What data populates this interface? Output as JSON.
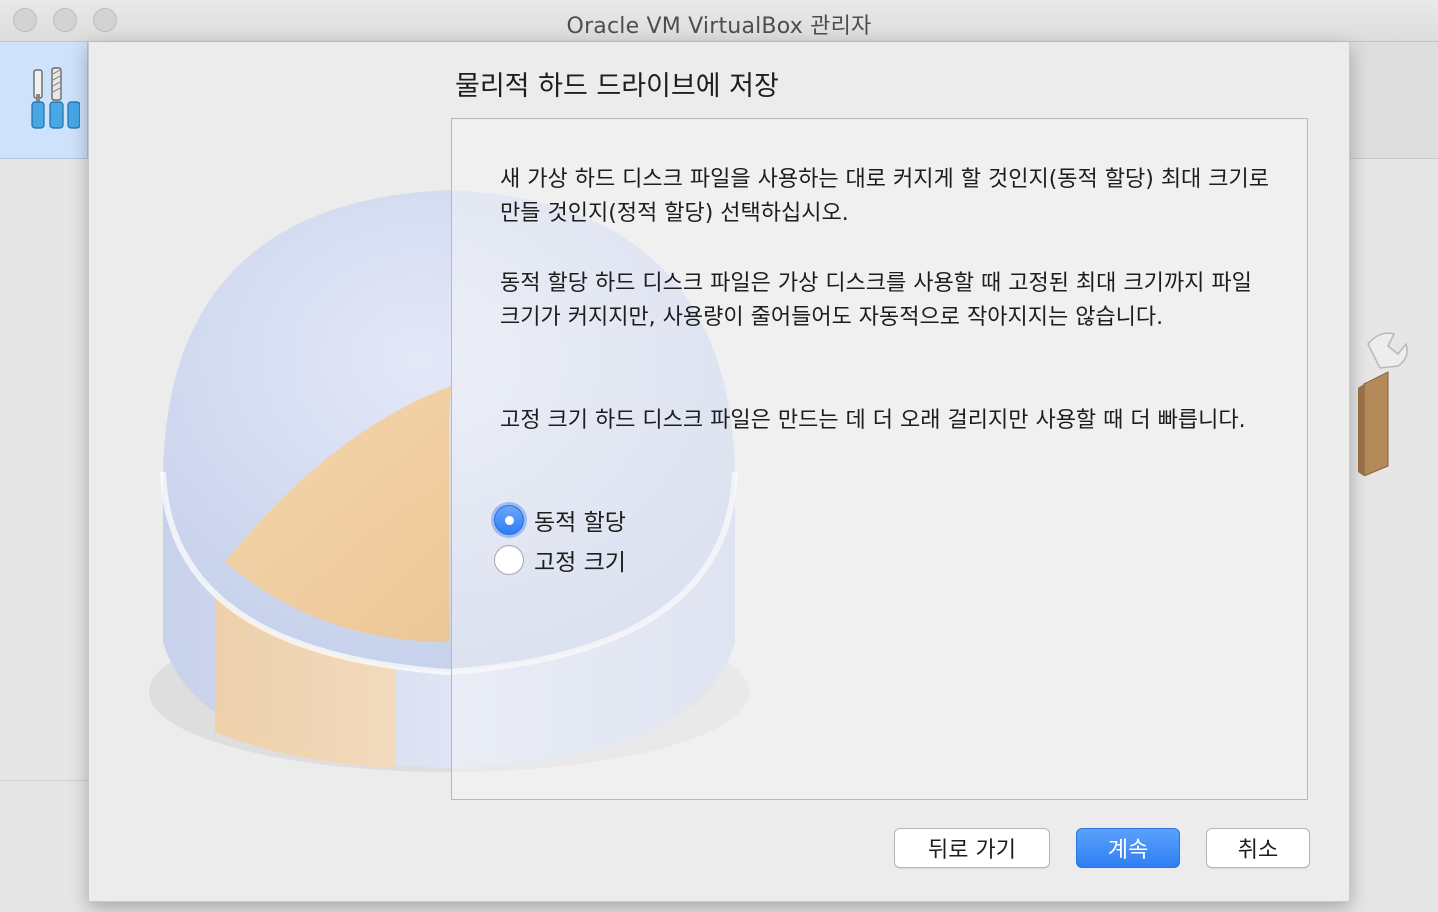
{
  "window": {
    "title": "Oracle VM VirtualBox 관리자"
  },
  "wizard": {
    "page_title": "물리적 하드 드라이브에 저장",
    "paragraphs": [
      "새 가상 하드 디스크 파일을 사용하는 대로 커지게 할 것인지(동적 할당) 최대 크기로 만들 것인지(정적 할당) 선택하십시오.",
      "동적 할당 하드 디스크 파일은 가상 디스크를 사용할 때 고정된 최대 크기까지 파일 크기가 커지지만, 사용량이 줄어들어도 자동적으로 작아지지는 않습니다.",
      "고정 크기 하드 디스크 파일은 만드는 데 더 오래 걸리지만 사용할 때 더 빠릅니다."
    ],
    "options": [
      {
        "label": "동적 할당",
        "selected": true
      },
      {
        "label": "고정 크기",
        "selected": false
      }
    ],
    "buttons": {
      "back": "뒤로 가기",
      "next": "계속",
      "cancel": "취소"
    }
  },
  "icons": {
    "window_controls": [
      "close-icon",
      "minimize-icon",
      "zoom-icon"
    ],
    "toolbar": "tools-icon",
    "wizard": "hard-disk-icon",
    "background": "wrench-box-icon"
  },
  "colors": {
    "accent": "#2f7ff3",
    "selected_bg": "#cfe2fb"
  }
}
